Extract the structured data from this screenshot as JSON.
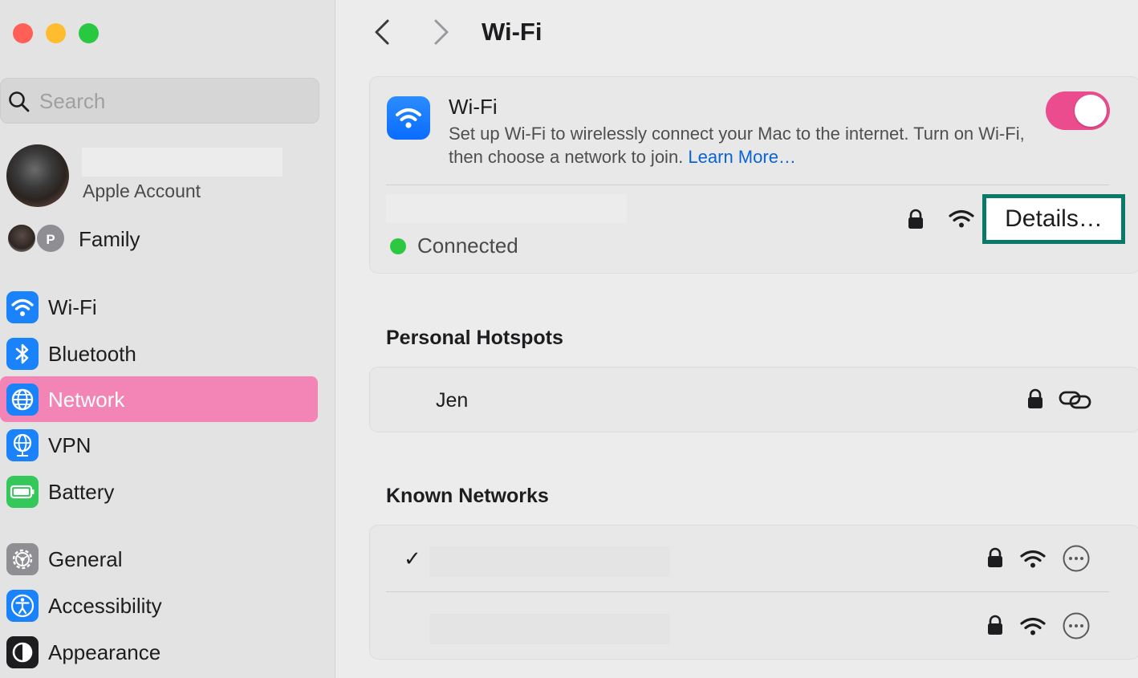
{
  "window": {
    "traffic_lights": [
      "close",
      "minimize",
      "zoom"
    ]
  },
  "sidebar": {
    "search": {
      "placeholder": "Search",
      "value": ""
    },
    "account": {
      "label": "Apple Account"
    },
    "family": {
      "label": "Family",
      "avatar_initial": "P"
    },
    "items": [
      {
        "label": "Wi-Fi",
        "icon": "wifi-icon",
        "color": "#1a82fb",
        "active": false
      },
      {
        "label": "Bluetooth",
        "icon": "bluetooth-icon",
        "color": "#1a82fb",
        "active": false
      },
      {
        "label": "Network",
        "icon": "globe-icon",
        "color": "#1a82fb",
        "active": true
      },
      {
        "label": "VPN",
        "icon": "vpn-globe-icon",
        "color": "#1a82fb",
        "active": false
      },
      {
        "label": "Battery",
        "icon": "battery-icon",
        "color": "#34c759",
        "active": false
      },
      {
        "label": "General",
        "icon": "gear-icon",
        "color": "#8e8e93",
        "active": false
      },
      {
        "label": "Accessibility",
        "icon": "accessibility-icon",
        "color": "#1a82fb",
        "active": false
      },
      {
        "label": "Appearance",
        "icon": "appearance-icon",
        "color": "#1d1d1f",
        "active": false
      }
    ],
    "active_color": "#f285b6"
  },
  "header": {
    "title": "Wi-Fi"
  },
  "wifi_card": {
    "title": "Wi-Fi",
    "description": "Set up Wi-Fi to wirelessly connect your Mac to the internet. Turn on Wi-Fi, then choose a network to join.",
    "learn_more": "Learn More…",
    "toggle_on": true,
    "toggle_color": "#ea4c8e",
    "details_button": "Details…",
    "status": "Connected",
    "status_color": "#2ec840"
  },
  "personal_hotspots": {
    "title": "Personal Hotspots",
    "items": [
      {
        "name": "Jen",
        "secured": true,
        "icon": "link-icon"
      }
    ]
  },
  "known_networks": {
    "title": "Known Networks",
    "rows": [
      {
        "checked": true,
        "check_mark": "✓",
        "secured": true
      },
      {
        "checked": false,
        "check_mark": "",
        "secured": true
      }
    ]
  }
}
